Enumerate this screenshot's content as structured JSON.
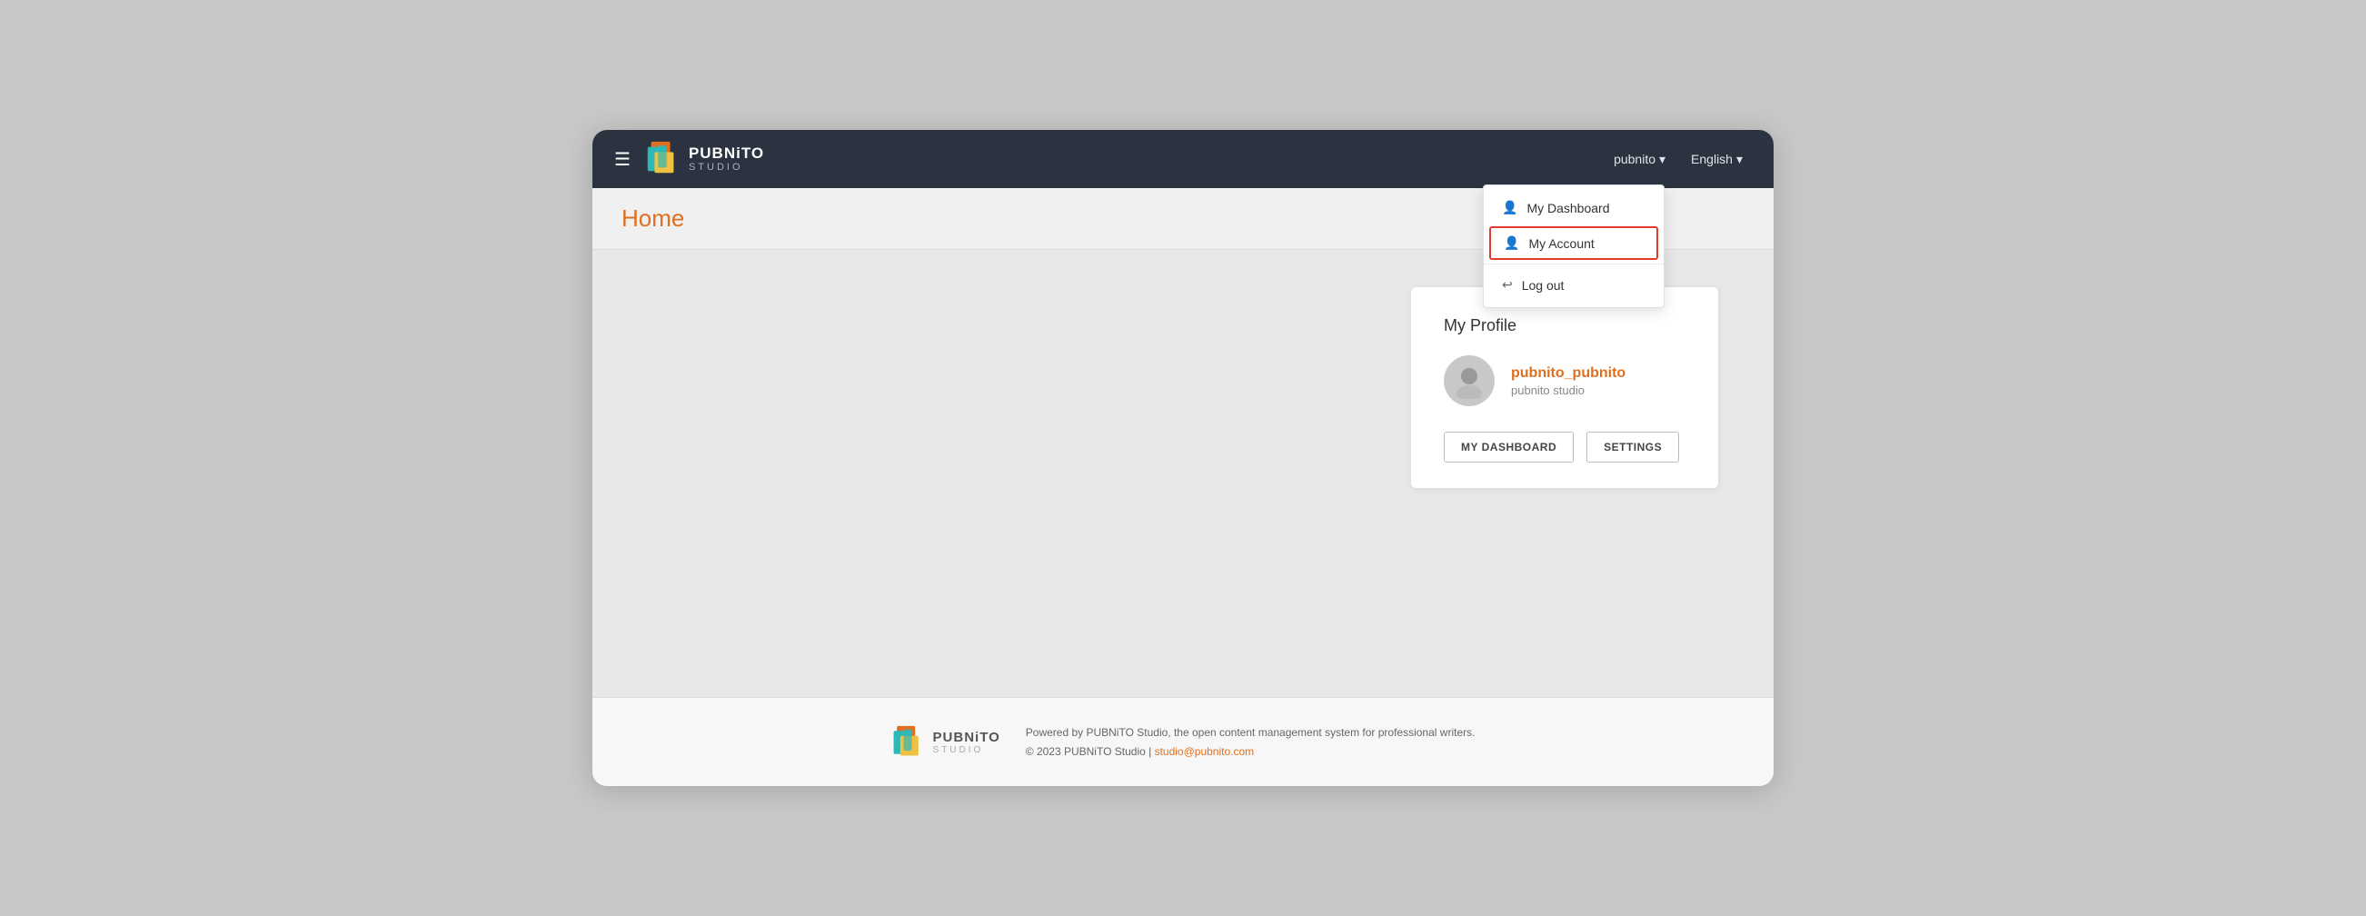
{
  "navbar": {
    "brand": "PUBNiTO",
    "sub": "STUDIO",
    "user_label": "pubnito",
    "lang_label": "English",
    "chevron": "▾"
  },
  "dropdown": {
    "items": [
      {
        "id": "my-dashboard",
        "icon": "👤",
        "label": "My Dashboard",
        "active": false
      },
      {
        "id": "my-account",
        "icon": "👤",
        "label": "My Account",
        "active": true
      },
      {
        "id": "log-out",
        "icon": "↩",
        "label": "Log out",
        "active": false
      }
    ]
  },
  "page": {
    "title": "Home"
  },
  "profile_card": {
    "title": "My Profile",
    "username": "pubnito_pubnito",
    "userdesc": "pubnito studio",
    "btn_dashboard": "MY DASHBOARD",
    "btn_settings": "SETTINGS"
  },
  "footer": {
    "brand": "PUBNiTO",
    "sub": "STUDIO",
    "powered_by": "Powered by PUBNiTO Studio, the open content management system for professional writers.",
    "copyright": "© 2023 PUBNiTO Studio | ",
    "email": "studio@pubnito.com"
  }
}
